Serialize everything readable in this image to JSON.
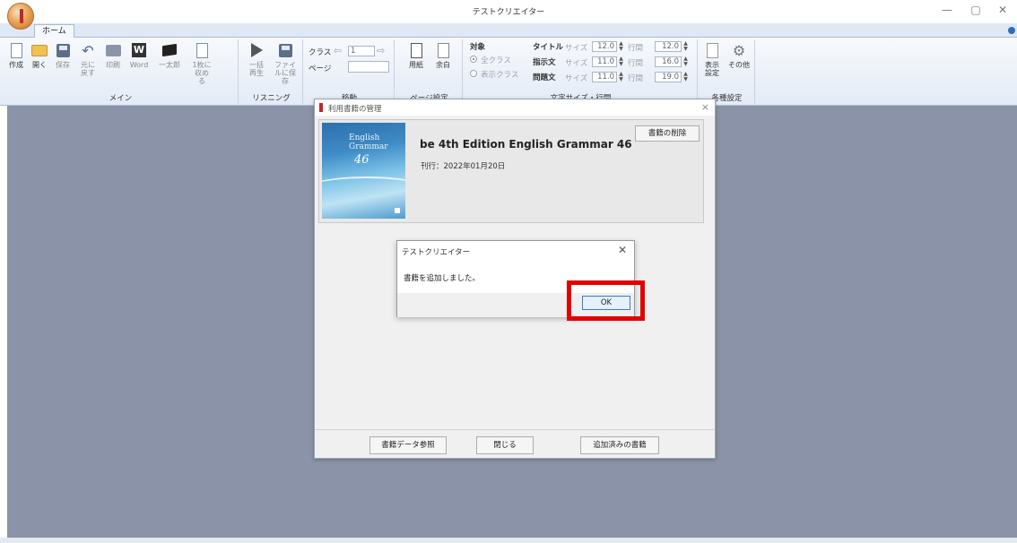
{
  "window": {
    "title": "テストクリエイター",
    "minimize": "—",
    "maximize": "▢",
    "close": "✕"
  },
  "tabs": [
    {
      "label": "ホーム"
    }
  ],
  "ribbon": {
    "main": {
      "label": "メイン",
      "buttons": [
        "作成",
        "開く",
        "保存",
        "元に戻す",
        "印刷",
        "Word",
        "一太郎",
        "1枚に収める"
      ]
    },
    "listening": {
      "label": "リスニング",
      "buttons": [
        "一括再生",
        "ファイルに保存"
      ]
    },
    "move": {
      "label": "移動",
      "class_label": "クラス",
      "page_label": "ページ",
      "class_value": "1"
    },
    "page_settings": {
      "label": "ページ設定",
      "paper": "用紙",
      "margin": "余白"
    },
    "font_size": {
      "label": "文字サイズ・行間",
      "target_label": "対象",
      "radio_all": "全クラス",
      "radio_display": "表示クラス",
      "rows": [
        {
          "name": "タイトル",
          "size_label": "サイズ",
          "size": "12.0",
          "spacing_label": "行間",
          "spacing": "12.0"
        },
        {
          "name": "指示文",
          "size_label": "サイズ",
          "size": "11.0",
          "spacing_label": "行間",
          "spacing": "16.0"
        },
        {
          "name": "問題文",
          "size_label": "サイズ",
          "size": "11.0",
          "spacing_label": "行間",
          "spacing": "19.0"
        }
      ]
    },
    "settings": {
      "label": "各種設定",
      "display": "表示設定",
      "other": "その他"
    }
  },
  "dialog": {
    "title": "利用書籍の管理",
    "book": {
      "cover_text_1": "English",
      "cover_text_2": "Grammar",
      "cover_number": "46",
      "title": "be 4th Edition English Grammar 46",
      "date": "刊行：2022年01月20日"
    },
    "delete_button": "書籍の削除",
    "bottom_buttons": {
      "reference": "書籍データ参照",
      "close": "閉じる",
      "added": "追加済みの書籍"
    }
  },
  "message_box": {
    "title": "テストクリエイター",
    "body": "書籍を追加しました。",
    "ok": "OK"
  },
  "colors": {
    "highlight": "#e40000",
    "workspace": "#8a93a7"
  }
}
